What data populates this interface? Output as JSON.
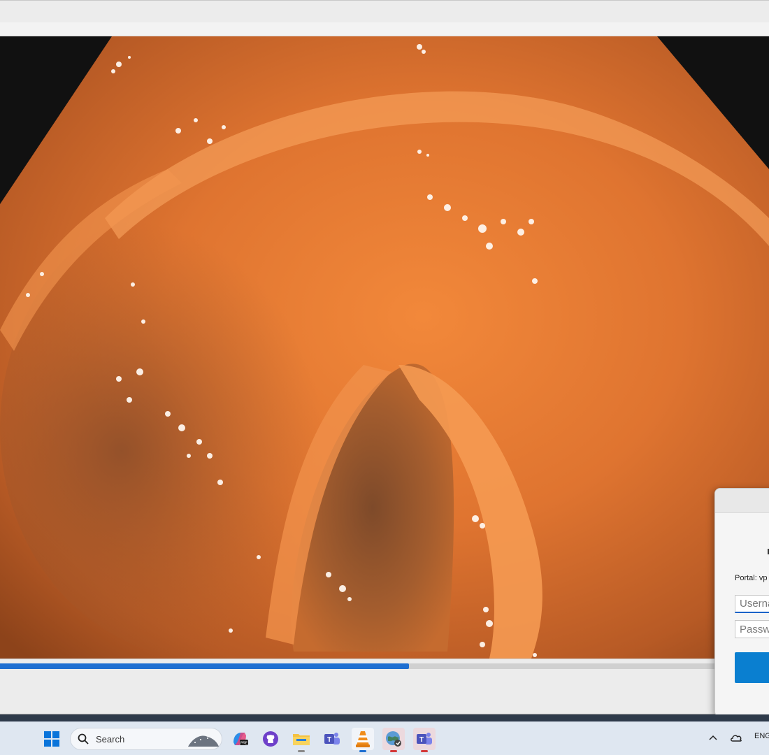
{
  "player": {
    "progress_fraction": 0.532
  },
  "login_dialog": {
    "portal_label": "Portal: vp",
    "username_placeholder": "Userna",
    "password_placeholder": "Passwo"
  },
  "taskbar": {
    "search_placeholder": "Search",
    "language": "ENG",
    "apps": [
      {
        "name": "copilot-icon"
      },
      {
        "name": "github-icon"
      },
      {
        "name": "file-explorer-icon"
      },
      {
        "name": "teams-icon"
      },
      {
        "name": "vlc-icon"
      },
      {
        "name": "globe-vpn-icon"
      },
      {
        "name": "teams-icon"
      }
    ],
    "colors": {
      "start_blue": "#0a74da",
      "accent": "#1f6fd1"
    }
  }
}
